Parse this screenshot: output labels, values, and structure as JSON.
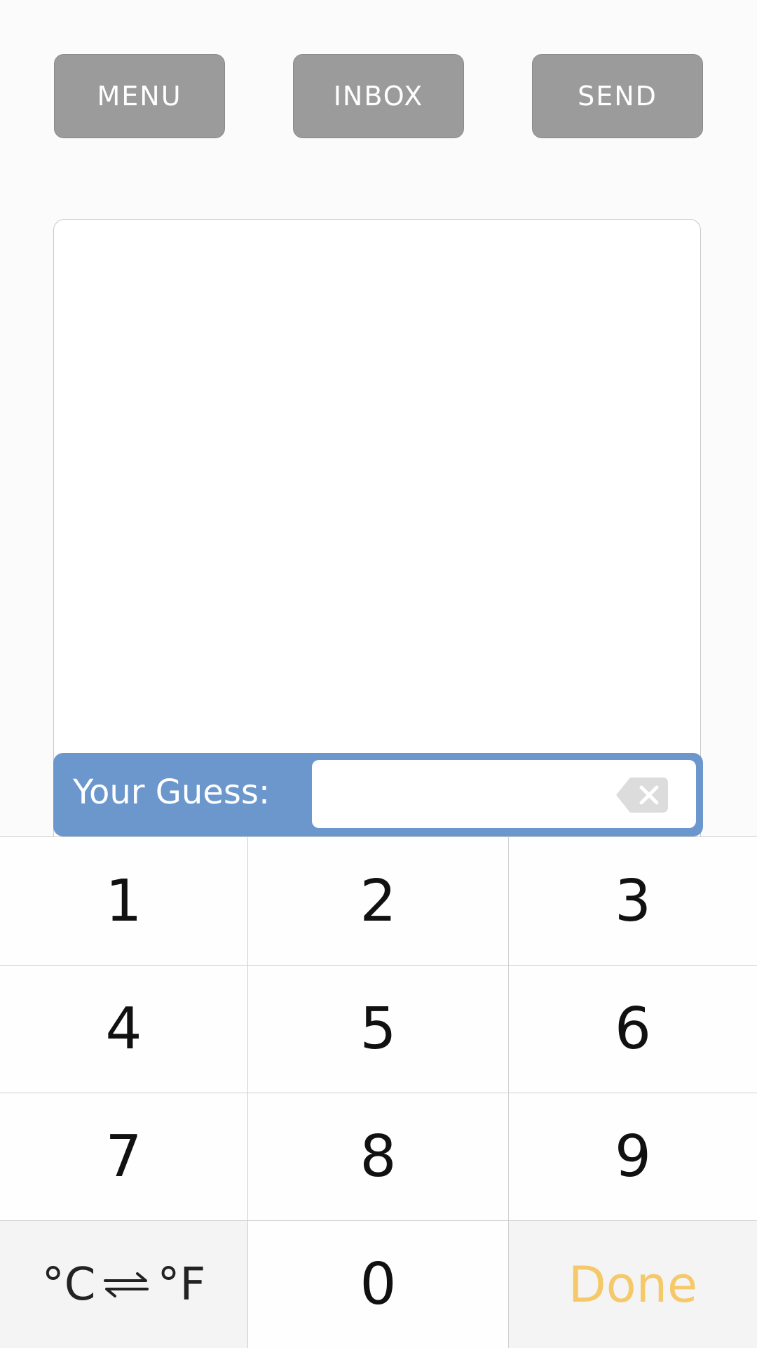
{
  "header": {
    "menu_label": "MENU",
    "inbox_label": "INBOX",
    "send_label": "SEND"
  },
  "guess": {
    "label": "Your Guess:",
    "value": "",
    "placeholder": ""
  },
  "keypad": {
    "keys": [
      "1",
      "2",
      "3",
      "4",
      "5",
      "6",
      "7",
      "8",
      "9"
    ],
    "zero": "0",
    "unit_toggle": {
      "celsius": "°C",
      "fahrenheit": "°F"
    },
    "done_label": "Done"
  },
  "colors": {
    "button_gray": "#9b9b9b",
    "guess_bar_blue": "#6b97cd",
    "done_yellow": "#f5c96a"
  },
  "icons": {
    "backspace": "backspace-icon",
    "unit_swap": "swap-arrows-icon"
  }
}
